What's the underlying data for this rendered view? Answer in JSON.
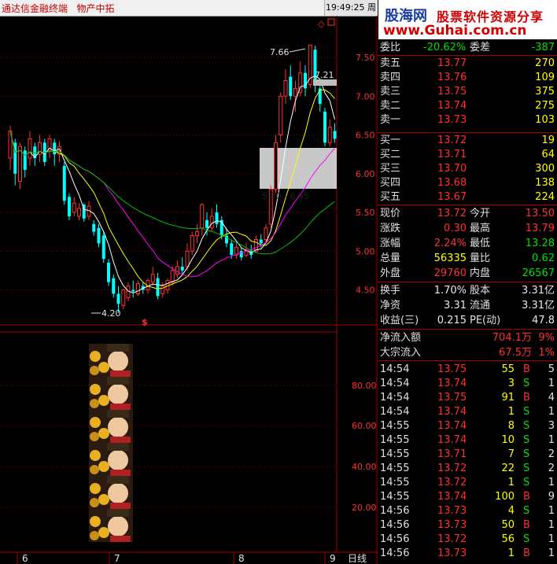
{
  "window": {
    "app_title": "通达信金融终端",
    "section": "物产中拓",
    "clock": "19:49:25",
    "weekday": "周三"
  },
  "banner": {
    "site_name": "股海网",
    "slogan": "股票软件资源分享",
    "url": "www.Guhai.com.cn"
  },
  "kline": {
    "annotations": {
      "high": "7.66",
      "last_high": "7.21",
      "range": "5.80 - 6.35",
      "low": "4.20",
      "marker": "$",
      "diamond": "◇"
    },
    "price_axis": [
      "7.50",
      "7.00",
      "6.50",
      "6.00",
      "5.50",
      "5.00",
      "4.50"
    ],
    "indicator_axis": [
      "80.00",
      "60.00",
      "40.00",
      "20.00"
    ],
    "date_axis": [
      "6",
      "7",
      "8",
      "9"
    ],
    "period_label": "日线",
    "colors": {
      "up": "#ff3232",
      "down": "#00ffff",
      "ma5": "#ffffff",
      "ma10": "#ffff00",
      "ma20": "#ff00ff",
      "ma60": "#00c000",
      "grid": "#8b0000"
    }
  },
  "quote": {
    "wei": {
      "label1": "委比",
      "value1": "-20.62%",
      "label2": "委差",
      "value2": "-387"
    },
    "sell": [
      {
        "label": "卖五",
        "price": "13.77",
        "vol": "270"
      },
      {
        "label": "卖四",
        "price": "13.76",
        "vol": "109"
      },
      {
        "label": "卖三",
        "price": "13.75",
        "vol": "375"
      },
      {
        "label": "卖二",
        "price": "13.74",
        "vol": "275"
      },
      {
        "label": "卖一",
        "price": "13.73",
        "vol": "103"
      }
    ],
    "buy": [
      {
        "label": "买一",
        "price": "13.72",
        "vol": "19"
      },
      {
        "label": "买二",
        "price": "13.71",
        "vol": "64"
      },
      {
        "label": "买三",
        "price": "13.70",
        "vol": "300"
      },
      {
        "label": "买四",
        "price": "13.68",
        "vol": "138"
      },
      {
        "label": "买五",
        "price": "13.67",
        "vol": "224"
      }
    ],
    "stats": [
      {
        "l1": "现价",
        "v1": "13.72",
        "c1": "red",
        "l2": "今开",
        "v2": "13.50",
        "c2": "red"
      },
      {
        "l1": "涨跌",
        "v1": "0.30",
        "c1": "red",
        "l2": "最高",
        "v2": "13.79",
        "c2": "red"
      },
      {
        "l1": "涨幅",
        "v1": "2.24%",
        "c1": "red",
        "l2": "最低",
        "v2": "13.28",
        "c2": "green"
      },
      {
        "l1": "总量",
        "v1": "56335",
        "c1": "yellow",
        "l2": "量比",
        "v2": "0.62",
        "c2": "green"
      },
      {
        "l1": "外盘",
        "v1": "29760",
        "c1": "red",
        "l2": "内盘",
        "v2": "26567",
        "c2": "green"
      }
    ],
    "fund": [
      {
        "l1": "换手",
        "v1": "1.70%",
        "l2": "股本",
        "v2": "3.31亿"
      },
      {
        "l1": "净资",
        "v1": "3.31",
        "l2": "流通",
        "v2": "3.31亿"
      },
      {
        "l1": "收益(三)",
        "v1": "0.215",
        "l2": "PE(动)",
        "v2": "47.8"
      }
    ],
    "flow": [
      {
        "label": "净流入额",
        "value": "704.1万",
        "pct": "9%"
      },
      {
        "label": "大宗流入",
        "value": "67.5万",
        "pct": "1%"
      }
    ],
    "ticks": [
      {
        "time": "14:54",
        "price": "13.75",
        "pc": "red",
        "vol": "55",
        "bs": "B",
        "n": "5"
      },
      {
        "time": "14:54",
        "price": "13.74",
        "pc": "red",
        "vol": "3",
        "bs": "S",
        "n": "1"
      },
      {
        "time": "14:54",
        "price": "13.75",
        "pc": "red",
        "vol": "91",
        "bs": "B",
        "n": "4"
      },
      {
        "time": "14:54",
        "price": "13.74",
        "pc": "red",
        "vol": "1",
        "bs": "S",
        "n": "1"
      },
      {
        "time": "14:55",
        "price": "13.74",
        "pc": "red",
        "vol": "8",
        "bs": "S",
        "n": "3"
      },
      {
        "time": "14:55",
        "price": "13.74",
        "pc": "red",
        "vol": "10",
        "bs": "S",
        "n": "1"
      },
      {
        "time": "14:55",
        "price": "13.71",
        "pc": "red",
        "vol": "7",
        "bs": "S",
        "n": "2"
      },
      {
        "time": "14:55",
        "price": "13.72",
        "pc": "red",
        "vol": "22",
        "bs": "S",
        "n": "2"
      },
      {
        "time": "14:55",
        "price": "13.72",
        "pc": "red",
        "vol": "1",
        "bs": "S",
        "n": "1"
      },
      {
        "time": "14:55",
        "price": "13.74",
        "pc": "red",
        "vol": "100",
        "bs": "B",
        "n": "9"
      },
      {
        "time": "14:56",
        "price": "13.73",
        "pc": "red",
        "vol": "4",
        "bs": "S",
        "n": "1"
      },
      {
        "time": "14:56",
        "price": "13.73",
        "pc": "red",
        "vol": "50",
        "bs": "B",
        "n": "1"
      },
      {
        "time": "14:56",
        "price": "13.72",
        "pc": "red",
        "vol": "56",
        "bs": "S",
        "n": "1"
      },
      {
        "time": "14:56",
        "price": "13.73",
        "pc": "red",
        "vol": "1",
        "bs": "B",
        "n": "1"
      }
    ]
  }
}
